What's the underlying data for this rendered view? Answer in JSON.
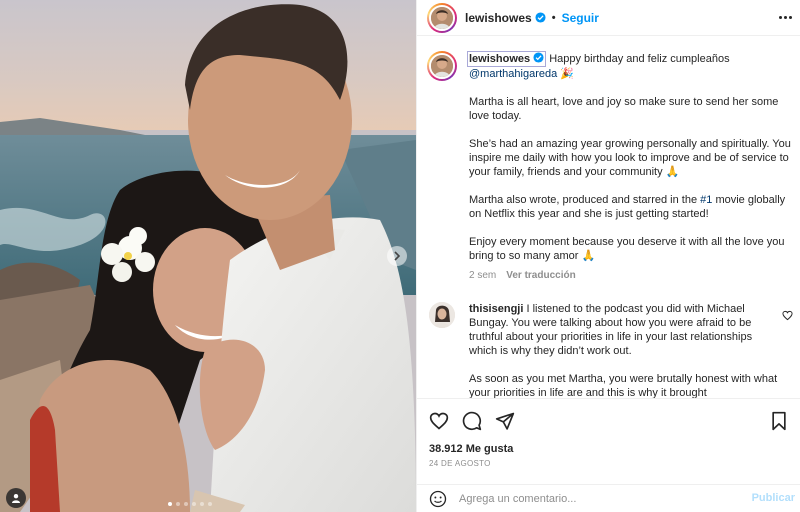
{
  "header": {
    "username": "lewishowes",
    "separator": "•",
    "follow_label": "Seguir",
    "avatar_icon": "user-avatar",
    "verified_icon": "verified-badge-icon",
    "more_icon": "more-options-icon"
  },
  "caption": {
    "username": "lewishowes",
    "intro": "Happy birthday and feliz cumpleaños",
    "mention": "@marthahigareda",
    "intro_emoji": "🎉",
    "p1": "Martha is all heart, love and joy so make sure to send her some love today.",
    "p2": "She’s had an amazing year growing personally and spiritually. You inspire me daily with how you look to improve and be of service to your family, friends and your community 🙏",
    "p3_before": "Martha also wrote, produced and starred in the ",
    "p3_hashtag": "#1",
    "p3_after": " movie globally on Netflix this year and she is just getting started!",
    "p4": "Enjoy every moment because you deserve it with all the love you bring to so many amor 🙏",
    "time": "2 sem",
    "translate": "Ver traducción"
  },
  "comment": {
    "username": "thisisengji",
    "p1": " I listened to the podcast you did with Michael Bungay. You were talking about how you were afraid to be truthful about your priorities in life in your last relationships which is why they didn’t work out.",
    "p2": "As soon as you met Martha, you were brutally honest with what your priorities in life are and this is why it brought"
  },
  "actions": {
    "icons": [
      "heart-icon",
      "comment-icon",
      "share-icon",
      "bookmark-icon"
    ],
    "likes": "38.912 Me gusta",
    "date": "24 DE AGOSTO"
  },
  "add_comment": {
    "emoji_icon": "emoji-icon",
    "placeholder": "Agrega un comentario...",
    "publish_label": "Publicar"
  },
  "carousel": {
    "total_slides": 6,
    "current_slide": 1
  },
  "colors": {
    "accent": "#0095f6",
    "link": "#00376b",
    "muted": "#8e8e8e",
    "publish_disabled": "#b2dffc"
  }
}
